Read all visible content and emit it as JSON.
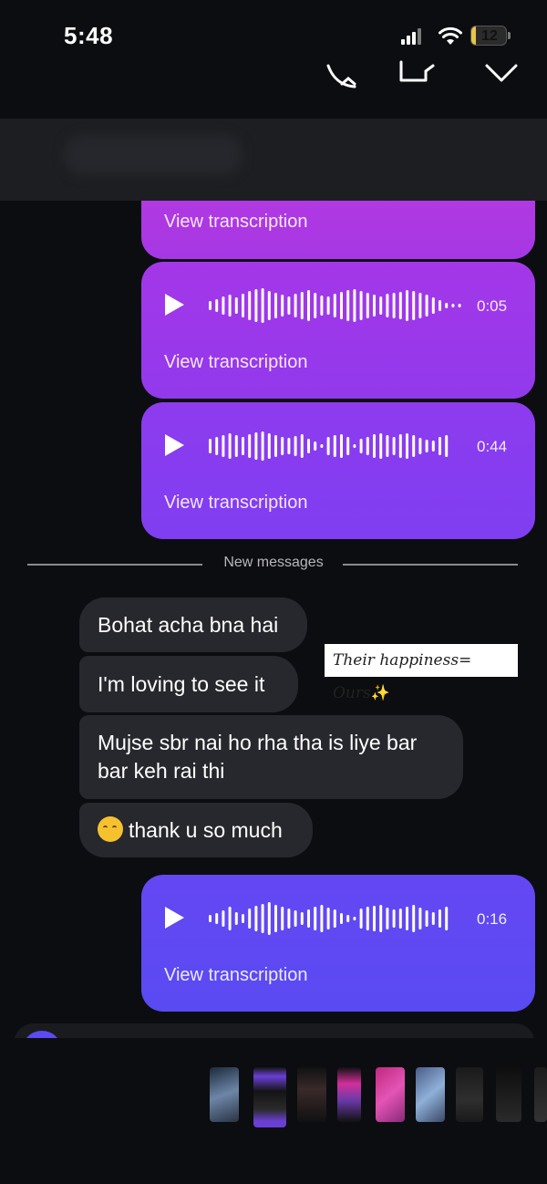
{
  "status_bar": {
    "time": "5:48",
    "battery": "12",
    "battery_level": 0.12
  },
  "header": {
    "icons": [
      "phone-icon",
      "video-icon",
      "chevron-down-icon"
    ]
  },
  "messages": {
    "outgoing_top": {
      "transcription_label": "View transcription"
    },
    "outgoing_voice": [
      {
        "duration": "0:05",
        "transcription_label": "View transcription"
      },
      {
        "duration": "0:44",
        "transcription_label": "View transcription"
      }
    ],
    "divider_label": "New messages",
    "incoming": [
      {
        "text": "Bohat acha bna hai"
      },
      {
        "text": "I'm loving to see it"
      },
      {
        "line1": "Mujse sbr nai ho rha tha is liye bar",
        "line2": "bar keh rai thi"
      },
      {
        "text": "thank u so much",
        "emoji": "sneezing-face-icon"
      }
    ],
    "sticker": {
      "text": "Their happiness= Ours",
      "sparkle": "✨"
    },
    "reply_voice": {
      "duration": "0:16",
      "transcription_label": "View transcription"
    }
  },
  "colors": {
    "bubble_pink": "#b236dd",
    "bubble_purple": "#8a3df0",
    "bubble_violet": "#5e4af2",
    "incoming_bubble": "#27282d"
  }
}
